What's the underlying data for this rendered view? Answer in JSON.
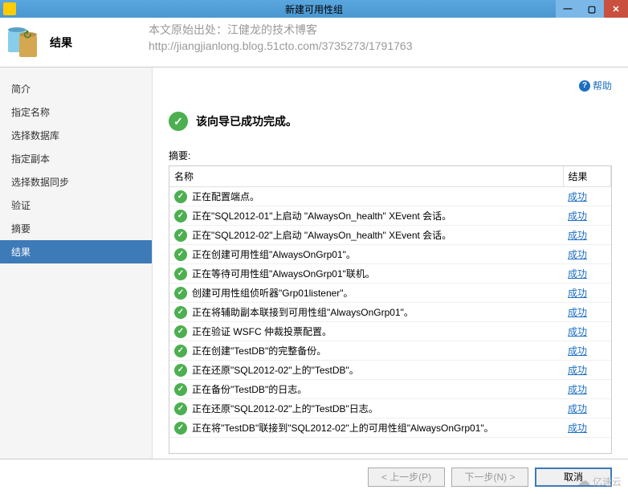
{
  "window": {
    "title": "新建可用性组"
  },
  "header": {
    "title": "结果"
  },
  "watermark": {
    "line1": "本文原始出处：江健龙的技术博客",
    "line2": "http://jiangjianlong.blog.51cto.com/3735273/1791763"
  },
  "sidebar": {
    "items": [
      {
        "label": "简介"
      },
      {
        "label": "指定名称"
      },
      {
        "label": "选择数据库"
      },
      {
        "label": "指定副本"
      },
      {
        "label": "选择数据同步"
      },
      {
        "label": "验证"
      },
      {
        "label": "摘要"
      },
      {
        "label": "结果",
        "active": true
      }
    ]
  },
  "main": {
    "help_label": "帮助",
    "result_message": "该向导已成功完成。",
    "summary_label": "摘要:",
    "columns": {
      "name": "名称",
      "result": "结果"
    },
    "rows": [
      {
        "name": "正在配置端点。",
        "result": "成功"
      },
      {
        "name": "正在\"SQL2012-01\"上启动 \"AlwaysOn_health\" XEvent 会话。",
        "result": "成功"
      },
      {
        "name": "正在\"SQL2012-02\"上启动 \"AlwaysOn_health\" XEvent 会话。",
        "result": "成功"
      },
      {
        "name": "正在创建可用性组\"AlwaysOnGrp01\"。",
        "result": "成功"
      },
      {
        "name": "正在等待可用性组\"AlwaysOnGrp01\"联机。",
        "result": "成功"
      },
      {
        "name": "创建可用性组侦听器\"Grp01listener\"。",
        "result": "成功"
      },
      {
        "name": "正在将辅助副本联接到可用性组\"AlwaysOnGrp01\"。",
        "result": "成功"
      },
      {
        "name": "正在验证 WSFC 仲裁投票配置。",
        "result": "成功"
      },
      {
        "name": "正在创建\"TestDB\"的完整备份。",
        "result": "成功"
      },
      {
        "name": "正在还原\"SQL2012-02\"上的\"TestDB\"。",
        "result": "成功"
      },
      {
        "name": "正在备份\"TestDB\"的日志。",
        "result": "成功"
      },
      {
        "name": "正在还原\"SQL2012-02\"上的\"TestDB\"日志。",
        "result": "成功"
      },
      {
        "name": "正在将\"TestDB\"联接到\"SQL2012-02\"上的可用性组\"AlwaysOnGrp01\"。",
        "result": "成功"
      }
    ]
  },
  "footer": {
    "prev": "< 上一步(P)",
    "next": "下一步(N) >",
    "cancel": "取消"
  },
  "brand": "亿速云"
}
